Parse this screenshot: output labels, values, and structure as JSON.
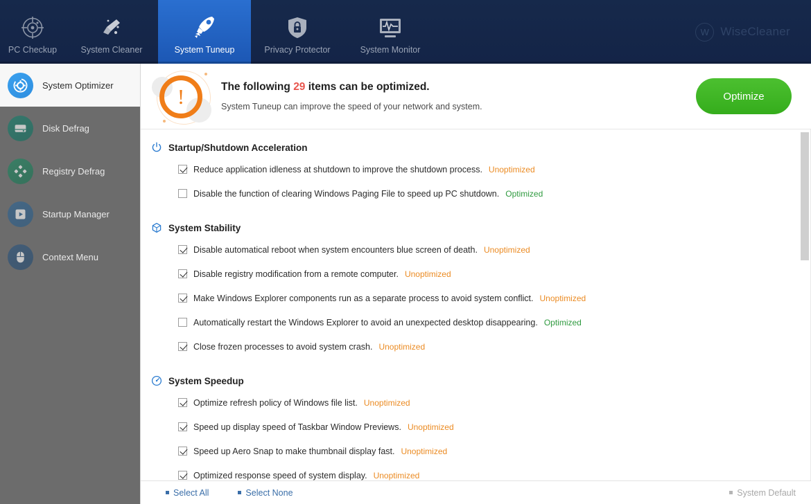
{
  "topnav": {
    "tabs": [
      {
        "label": "PC Checkup",
        "icon": "target-icon",
        "active": false
      },
      {
        "label": "System Cleaner",
        "icon": "broom-icon",
        "active": false
      },
      {
        "label": "System Tuneup",
        "icon": "rocket-icon",
        "active": true
      },
      {
        "label": "Privacy Protector",
        "icon": "shield-lock-icon",
        "active": false
      },
      {
        "label": "System Monitor",
        "icon": "monitor-pulse-icon",
        "active": false
      }
    ],
    "brand": "WiseCleaner",
    "brand_mark": "W"
  },
  "sidebar": {
    "items": [
      {
        "label": "System Optimizer",
        "icon": "gear-circle-icon",
        "active": true,
        "color": "#3aa0ee"
      },
      {
        "label": "Disk Defrag",
        "icon": "harddisk-icon",
        "active": false,
        "color": "#13806d"
      },
      {
        "label": "Registry Defrag",
        "icon": "registry-icon",
        "active": false,
        "color": "#1c8a62"
      },
      {
        "label": "Startup Manager",
        "icon": "play-icon",
        "active": false,
        "color": "#2d6596"
      },
      {
        "label": "Context Menu",
        "icon": "mouse-icon",
        "active": false,
        "color": "#2a5580"
      }
    ]
  },
  "header": {
    "icon": "warning-exclamation-icon",
    "line1_prefix": "The following",
    "count": "29",
    "line1_suffix": "items can be optimized.",
    "line2": "System Tuneup can improve the speed of your network and system.",
    "optimize_label": "Optimize",
    "accent_orange": "#f07d18",
    "count_color": "#e8554d",
    "optimize_color": "#3aae1f"
  },
  "sections": [
    {
      "title": "Startup/Shutdown Acceleration",
      "icon": "power-icon",
      "items": [
        {
          "label": "Reduce application idleness at shutdown to improve the shutdown process.",
          "checked": true,
          "status": "Unoptimized"
        },
        {
          "label": "Disable the function of clearing Windows Paging File to speed up PC shutdown.",
          "checked": false,
          "status": "Optimized"
        }
      ]
    },
    {
      "title": "System Stability",
      "icon": "cube-icon",
      "items": [
        {
          "label": "Disable automatical reboot when system encounters blue screen of death.",
          "checked": true,
          "status": "Unoptimized"
        },
        {
          "label": "Disable registry modification from a remote computer.",
          "checked": true,
          "status": "Unoptimized"
        },
        {
          "label": "Make Windows Explorer components run as a separate process to avoid system conflict.",
          "checked": true,
          "status": "Unoptimized"
        },
        {
          "label": "Automatically restart the Windows Explorer to avoid an unexpected desktop disappearing.",
          "checked": false,
          "status": "Optimized"
        },
        {
          "label": "Close frozen processes to avoid system crash.",
          "checked": true,
          "status": "Unoptimized"
        }
      ]
    },
    {
      "title": "System Speedup",
      "icon": "speedometer-icon",
      "items": [
        {
          "label": "Optimize refresh policy of Windows file list.",
          "checked": true,
          "status": "Unoptimized"
        },
        {
          "label": "Speed up display speed of Taskbar Window Previews.",
          "checked": true,
          "status": "Unoptimized"
        },
        {
          "label": "Speed up Aero Snap to make thumbnail display fast.",
          "checked": true,
          "status": "Unoptimized"
        },
        {
          "label": "Optimized response speed of system display.",
          "checked": true,
          "status": "Unoptimized"
        }
      ]
    }
  ],
  "footer": {
    "select_all": "Select All",
    "select_none": "Select None",
    "system_default": "System Default",
    "link_color": "#3a6ea8"
  },
  "status_colors": {
    "unoptimized": "#eb8b23",
    "optimized": "#2f9a3f"
  }
}
